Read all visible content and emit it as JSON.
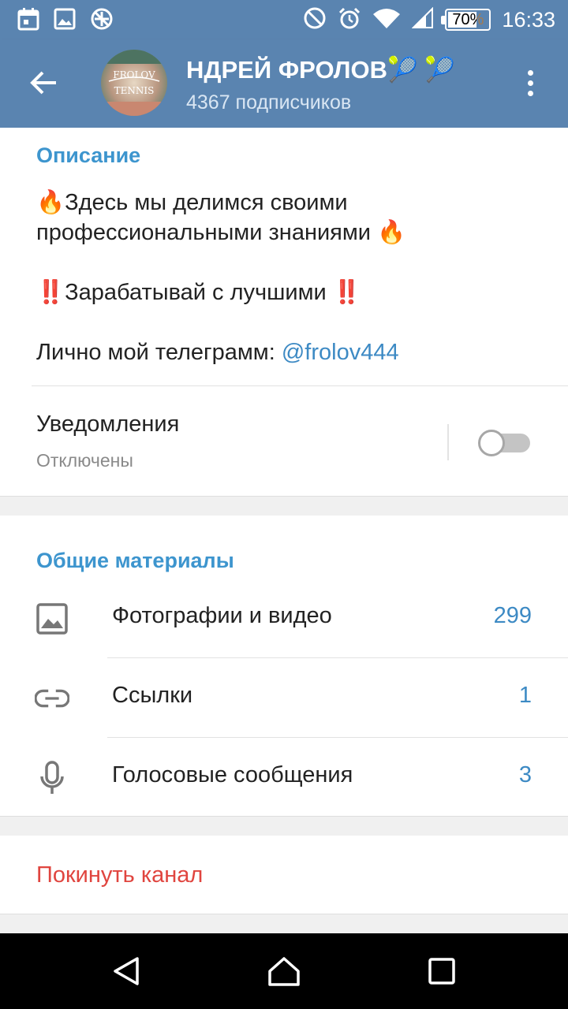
{
  "status_bar": {
    "battery_level": "70%",
    "time": "16:33",
    "left_icons": [
      "calendar-icon",
      "image-icon",
      "blocked-icon"
    ],
    "right_icons": [
      "do-not-disturb-icon",
      "alarm-icon",
      "wifi-icon",
      "signal-icon",
      "battery-icon"
    ]
  },
  "header": {
    "title": "НДРЕЙ ФРОЛОВ🎾  🎾",
    "subscribers": "4367 подписчиков",
    "avatar_text_line1": "FROLOV",
    "avatar_text_line2": "TENNIS",
    "icons": [
      "back-arrow-icon",
      "more-vertical-icon"
    ]
  },
  "description": {
    "section_title": "Описание",
    "line1": "🔥Здесь мы делимся своими",
    "line2": "профессиональными знаниями 🔥",
    "line3": "‼️Зарабатывай с лучшими ‼️",
    "line4_prefix": "Лично мой телеграмм: ",
    "mention": "@frolov444"
  },
  "notifications": {
    "label": "Уведомления",
    "status": "Отключены",
    "enabled": false
  },
  "shared_media": {
    "section_title": "Общие материалы",
    "items": [
      {
        "label": "Фотографии и видео",
        "count": "299",
        "icon": "photo-icon"
      },
      {
        "label": "Ссылки",
        "count": "1",
        "icon": "link-icon"
      },
      {
        "label": "Голосовые сообщения",
        "count": "3",
        "icon": "microphone-icon"
      }
    ]
  },
  "leave_channel": {
    "label": "Покинуть канал",
    "color": "#e0453f"
  },
  "colors": {
    "header": "#5a84b0",
    "accent": "#3d95ce",
    "danger": "#e0453f"
  },
  "nav_bar": {
    "icons": [
      "back-triangle-icon",
      "home-icon",
      "recents-icon"
    ]
  }
}
